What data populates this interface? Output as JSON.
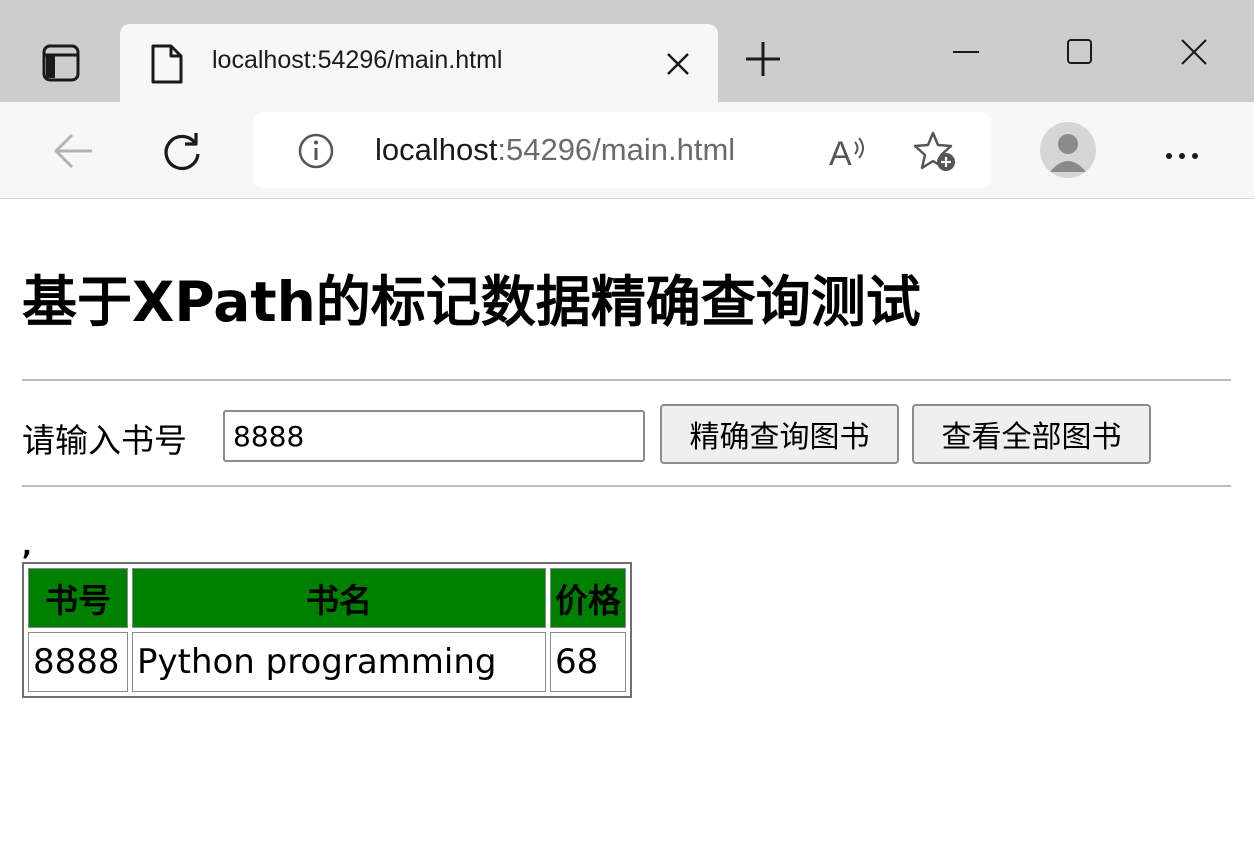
{
  "browser": {
    "tab_title": "localhost:54296/main.html",
    "url_host": "localhost",
    "url_rest": ":54296/main.html",
    "icons": [
      "tab-actions-icon",
      "document-icon",
      "close-icon",
      "plus-icon",
      "minimize-icon",
      "maximize-icon",
      "window-close-icon",
      "back-arrow-icon",
      "reload-icon",
      "info-icon",
      "read-aloud-icon",
      "favorites-add-icon",
      "profile-avatar-icon",
      "more-icon"
    ]
  },
  "page": {
    "title": "基于XPath的标记数据精确查询测试",
    "search_label": "请输入书号",
    "search_value": "8888",
    "exact_button": "精确查询图书",
    "all_button": "查看全部图书",
    "stray_text": ","
  },
  "table": {
    "header_color": "#008000",
    "headers": [
      "书号",
      "书名",
      "价格"
    ],
    "rows": [
      [
        "8888",
        "Python programming",
        "68"
      ]
    ]
  }
}
